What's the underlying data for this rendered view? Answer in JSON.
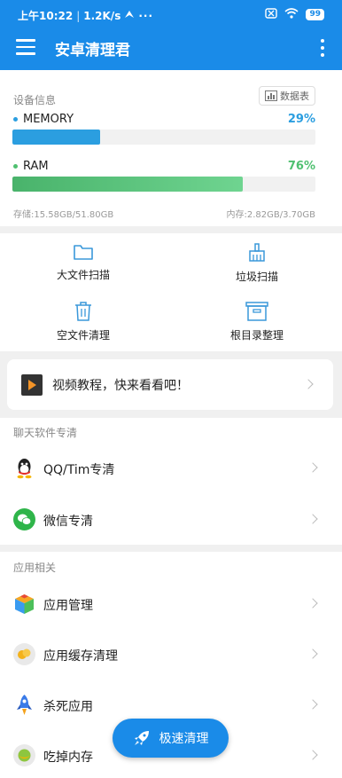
{
  "status_bar": {
    "time": "上午10:22",
    "speed": "1.2K/s",
    "dots": "···",
    "battery": "99"
  },
  "app_bar": {
    "title": "安卓清理君"
  },
  "device_info": {
    "label": "设备信息",
    "chart_button": "数据表",
    "memory": {
      "name": "MEMORY",
      "percent_text": "29%",
      "percent": 29,
      "color": "#2b9ee0"
    },
    "ram": {
      "name": "RAM",
      "percent_text": "76%",
      "percent": 76,
      "color": "#4fc070"
    },
    "storage": "存储:15.58GB/51.80GB",
    "memory_usage": "内存:2.82GB/3.70GB"
  },
  "tools": [
    {
      "label": "大文件扫描",
      "icon": "folder-icon"
    },
    {
      "label": "垃圾扫描",
      "icon": "broom-icon"
    },
    {
      "label": "空文件清理",
      "icon": "trash-icon"
    },
    {
      "label": "根目录整理",
      "icon": "box-icon"
    }
  ],
  "video_card": {
    "text": "视频教程，快来看看吧！"
  },
  "chat_section": {
    "label": "聊天软件专清",
    "items": [
      {
        "label": "QQ/Tim专清",
        "icon": "qq-icon"
      },
      {
        "label": "微信专清",
        "icon": "wechat-icon"
      }
    ]
  },
  "app_section": {
    "label": "应用相关",
    "items": [
      {
        "label": "应用管理",
        "icon": "cube-icon"
      },
      {
        "label": "应用缓存清理",
        "icon": "cache-icon"
      },
      {
        "label": "杀死应用",
        "icon": "rocket-icon"
      },
      {
        "label": "吃掉内存",
        "icon": "memory-eat-icon"
      }
    ]
  },
  "fab": {
    "label": "极速清理",
    "icon": "rocket-icon"
  },
  "colors": {
    "primary": "#1a8be8",
    "memory": "#2b9ee0",
    "ram": "#4fc070"
  }
}
